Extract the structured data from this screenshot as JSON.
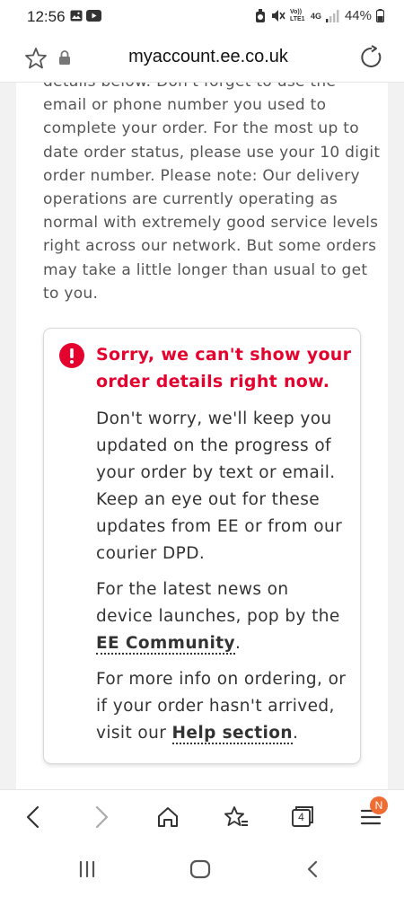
{
  "status_bar": {
    "time": "12:56",
    "network_label": "4G",
    "volte_label": "Vo)) LTE1",
    "battery": "44%"
  },
  "url_bar": {
    "url": "myaccount.ee.co.uk"
  },
  "intro_lines": [
    "details below. Don't forget to use the",
    "email or phone number you used to",
    "complete your order. For the most up to",
    "date order status, please use your 10 digit",
    "order number. Please note: Our delivery",
    "operations are currently operating as",
    "normal with extremely good service levels",
    "right across our network. But some orders",
    "may take a little longer than usual to get",
    "to you."
  ],
  "alert": {
    "title_line1": "Sorry, we can't show your",
    "title_line2": "order details right now.",
    "para1": [
      "Don't worry, we'll keep you",
      "updated on the progress of",
      "your order by text or email.",
      "Keep an eye out for these",
      "updates from EE or from our",
      "courier DPD."
    ],
    "para2_line1": "For the latest news on",
    "para2_line2": "device launches, pop by the",
    "community_link": "EE Community",
    "para2_end": ".",
    "para3_line1": "For more info on ordering, or",
    "para3_line2": "if your order hasn't arrived,",
    "para3_prefix": "visit our ",
    "help_link": "Help section",
    "para3_end": "."
  },
  "toolbar": {
    "tabs_count": "4",
    "menu_badge": "N"
  },
  "colors": {
    "alert_red": "#e4032e",
    "badge_orange": "#ef6c33",
    "page_bg": "#f3f2f3"
  }
}
